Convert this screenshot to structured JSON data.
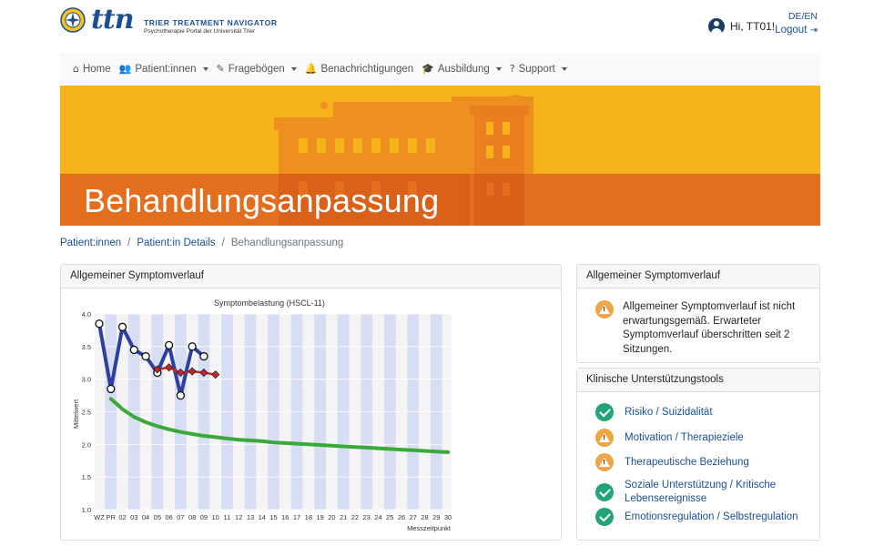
{
  "header": {
    "logo_text": "ttn",
    "app_title": "TRIER TREATMENT NAVIGATOR",
    "app_subtitle": "Psychotherapie Portal der Universität Trier",
    "greeting": "Hi, TT01!",
    "language": "DE/EN",
    "logout": "Logout"
  },
  "nav": [
    {
      "label": "Home",
      "icon": "home-icon",
      "dropdown": false
    },
    {
      "label": "Patient:innen",
      "icon": "users-icon",
      "dropdown": true
    },
    {
      "label": "Fragebögen",
      "icon": "edit-icon",
      "dropdown": true
    },
    {
      "label": "Benachrichtigungen",
      "icon": "bell-icon",
      "dropdown": false
    },
    {
      "label": "Ausbildung",
      "icon": "graduation-cap-icon",
      "dropdown": true
    },
    {
      "label": "Support",
      "icon": "question-circle-icon",
      "dropdown": true
    }
  ],
  "hero": {
    "title": "Behandlungsanpassung"
  },
  "breadcrumb": {
    "items": [
      "Patient:innen",
      "Patient:in Details"
    ],
    "current": "Behandlungsanpassung"
  },
  "chart_card": {
    "title": "Allgemeiner Symptomverlauf"
  },
  "alert_card": {
    "title": "Allgemeiner Symptomverlauf",
    "message": "Allgemeiner Symptomverlauf ist nicht erwartungsgemäß. Erwarteter Symptomverlauf überschritten seit 2 Sitzungen."
  },
  "tools_card": {
    "title": "Klinische Unterstützungstools",
    "items": [
      {
        "label": "Risiko / Suizidalität",
        "status": "ok"
      },
      {
        "label": "Motivation / Therapieziele",
        "status": "warning"
      },
      {
        "label": "Therapeutische Beziehung",
        "status": "warning"
      },
      {
        "label": "Soziale Unterstützung / Kritische Lebensereignisse",
        "status": "ok"
      },
      {
        "label": "Emotionsregulation / Selbstregulation",
        "status": "ok"
      }
    ]
  },
  "colors": {
    "brand_blue": "#1b4f95",
    "hero_yellow": "#f6b31b",
    "hero_orange": "#e36f1e",
    "status_ok": "#22a37a",
    "status_warning": "#f0a543",
    "series_observed": "#2e3f9e",
    "series_adjusted": "#c62828",
    "series_expected": "#3aa93a"
  },
  "chart_data": {
    "type": "line",
    "title": "Symptombelastung (HSCL-11)",
    "xlabel": "Messzeitpunkt",
    "ylabel": "Mittelwert",
    "ylim": [
      1.0,
      4.0
    ],
    "yticks": [
      "1.0",
      "1.5",
      "2.0",
      "2.5",
      "3.0",
      "3.5",
      "4.0"
    ],
    "categories": [
      "WZ",
      "PR",
      "02",
      "03",
      "04",
      "05",
      "06",
      "07",
      "08",
      "09",
      "10",
      "11",
      "12",
      "13",
      "14",
      "15",
      "16",
      "17",
      "18",
      "19",
      "20",
      "21",
      "22",
      "23",
      "24",
      "25",
      "26",
      "27",
      "28",
      "29",
      "30"
    ],
    "series": [
      {
        "values": [
          3.85,
          2.85,
          3.8,
          3.45,
          3.35,
          3.1,
          3.52,
          2.75,
          3.5,
          3.35
        ]
      },
      {
        "values": [
          null,
          null,
          null,
          null,
          null,
          3.15,
          3.18,
          3.1,
          3.12,
          3.1,
          3.07
        ]
      },
      {
        "values": [
          null,
          2.7,
          2.54,
          2.42,
          2.34,
          2.28,
          2.23,
          2.19,
          2.16,
          2.13,
          2.11,
          2.09,
          2.07,
          2.06,
          2.05,
          2.03,
          2.02,
          2.01,
          2.0,
          1.99,
          1.98,
          1.97,
          1.96,
          1.95,
          1.94,
          1.93,
          1.92,
          1.91,
          1.9,
          1.89,
          1.88
        ]
      }
    ]
  }
}
